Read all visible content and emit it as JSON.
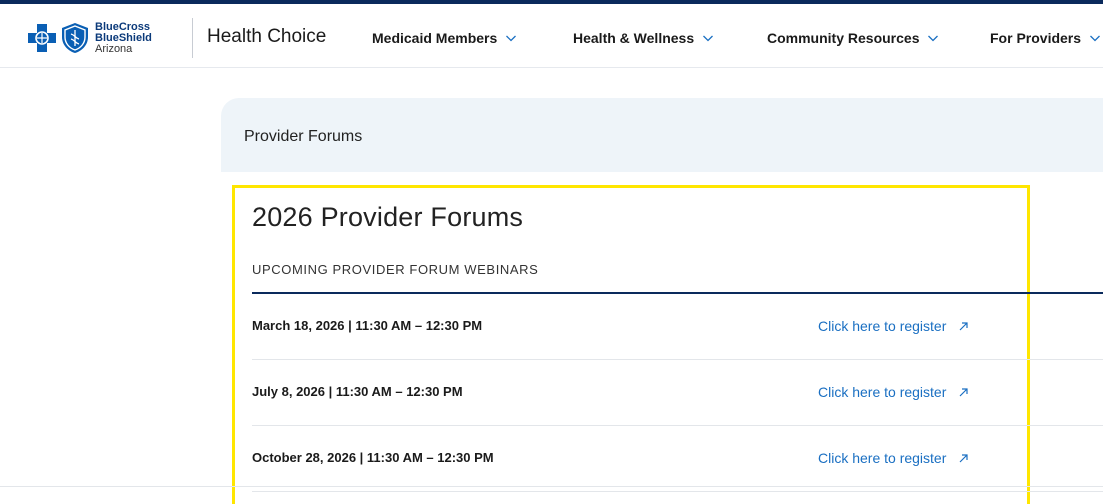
{
  "logo": {
    "line1": "BlueCross",
    "line2": "BlueShield",
    "line3": "Arizona",
    "colors": {
      "brand_blue": "#0a5fb4",
      "dark_navy": "#0a2a5c"
    }
  },
  "brand": {
    "name": "Health Choice"
  },
  "nav": {
    "items": [
      {
        "label": "Medicaid Members",
        "icon": "chevron-down-icon"
      },
      {
        "label": "Health & Wellness",
        "icon": "chevron-down-icon"
      },
      {
        "label": "Community Resources",
        "icon": "chevron-down-icon"
      },
      {
        "label": "For Providers",
        "icon": "chevron-down-icon"
      }
    ]
  },
  "breadcrumb": {
    "current": "Provider Forums"
  },
  "section": {
    "title": "2026 Provider Forums",
    "subtitle": "UPCOMING PROVIDER FORUM WEBINARS"
  },
  "forums": [
    {
      "date": "March 18, 2026",
      "time": " | 11:30 AM – 12:30 PM",
      "link_label": "Click here to register",
      "icon": "external-link-icon"
    },
    {
      "date": "July 8, 2026",
      "time": " | 11:30 AM – 12:30 PM",
      "link_label": "Click here to register",
      "icon": "external-link-icon"
    },
    {
      "date": "October 28, 2026",
      "time": " | 11:30 AM – 12:30 PM",
      "link_label": "Click here to register",
      "icon": "external-link-icon"
    }
  ],
  "highlight_color": "#ffe600",
  "link_color": "#1a6fc2"
}
